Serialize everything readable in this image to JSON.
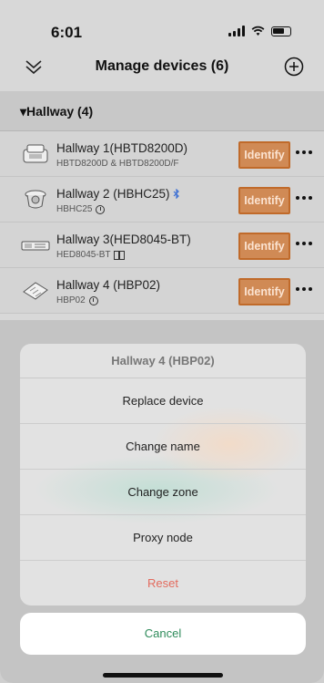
{
  "status_bar": {
    "time": "6:01"
  },
  "nav": {
    "title": "Manage devices (6)"
  },
  "section": {
    "title": "▾Hallway (4)"
  },
  "devices": [
    {
      "name": "Hallway 1(HBTD8200D)",
      "sub": "HBTD8200D & HBTD8200D/F",
      "sub_icon": "none",
      "image": "flush-sensor-image"
    },
    {
      "name": "Hallway 2 (HBHC25)",
      "sub": "HBHC25",
      "sub_icon": "clock-icon",
      "name_icon": "bluetooth-icon",
      "image": "ceiling-sensor-image"
    },
    {
      "name": "Hallway 3(HED8045-BT)",
      "sub": "HED8045-BT",
      "sub_icon": "panel-icon",
      "image": "driver-image"
    },
    {
      "name": "Hallway 4 (HBP02)",
      "sub": "HBP02",
      "sub_icon": "clock-icon",
      "image": "push-button-image"
    }
  ],
  "identify_label": "Identify",
  "action_sheet": {
    "title": "Hallway 4 (HBP02)",
    "items": [
      "Replace device",
      "Change name",
      "Change zone",
      "Proxy node",
      "Reset"
    ]
  },
  "cancel_label": "Cancel",
  "colors": {
    "identify_bg": "#d08a55",
    "identify_border": "#c06a2a",
    "reset_text": "#e36b5e",
    "cancel_text": "#2e8b5a"
  }
}
